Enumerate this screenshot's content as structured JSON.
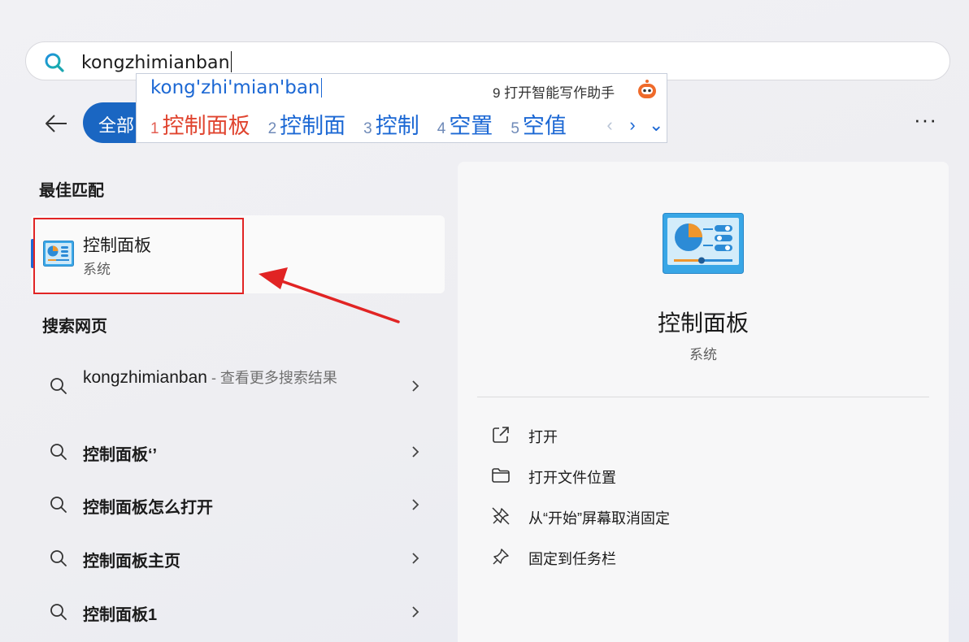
{
  "search": {
    "query": "kongzhimianban"
  },
  "ime": {
    "pinyin": "kong'zhi'mian'ban",
    "assistant_label": "9 打开智能写作助手",
    "candidates": [
      {
        "num": "1",
        "text": "控制面板"
      },
      {
        "num": "2",
        "text": "控制面"
      },
      {
        "num": "3",
        "text": "控制"
      },
      {
        "num": "4",
        "text": "空置"
      },
      {
        "num": "5",
        "text": "空值"
      }
    ],
    "nav": {
      "prev": "‹",
      "next": "›",
      "expand": "⌄"
    }
  },
  "filter": {
    "active_label": "全部",
    "more": "···"
  },
  "best_match": {
    "heading": "最佳匹配",
    "name": "控制面板",
    "category": "系统"
  },
  "web": {
    "heading": "搜索网页",
    "first": {
      "query": "kongzhimianban",
      "suffix": " - 查看更多搜索结果"
    },
    "items": [
      {
        "label": "控制面板‘’"
      },
      {
        "label": "控制面板怎么打开"
      },
      {
        "label": "控制面板主页"
      },
      {
        "label": "控制面板1"
      }
    ]
  },
  "detail": {
    "title": "控制面板",
    "subtitle": "系统",
    "actions": [
      {
        "icon": "open-external-icon",
        "label": "打开"
      },
      {
        "icon": "folder-icon",
        "label": "打开文件位置"
      },
      {
        "icon": "unpin-icon",
        "label": "从“开始”屏幕取消固定"
      },
      {
        "icon": "pin-icon",
        "label": "固定到任务栏"
      }
    ]
  },
  "colors": {
    "accent": "#1a66c2",
    "ime_blue": "#1c68d4",
    "first_candidate": "#e0442f",
    "annotation_red": "#e12424"
  }
}
